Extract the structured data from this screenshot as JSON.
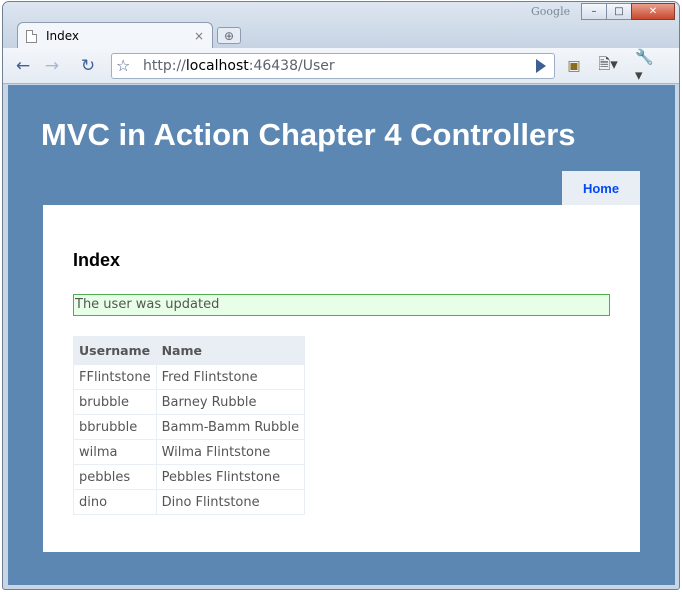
{
  "browser": {
    "brand": "Google",
    "tab": {
      "title": "Index",
      "close": "×"
    },
    "new_tab_icon": "plus-icon",
    "url_scheme": "http://",
    "url_host": "localhost",
    "url_rest": ":46438/User"
  },
  "site": {
    "title": "MVC in Action Chapter 4 Controllers",
    "nav": {
      "home": "Home"
    }
  },
  "page": {
    "heading": "Index",
    "message": "The user was updated",
    "table": {
      "headers": [
        "Username",
        "Name"
      ],
      "rows": [
        [
          "FFlintstone",
          "Fred Flintstone"
        ],
        [
          "brubble",
          "Barney Rubble"
        ],
        [
          "bbrubble",
          "Bamm-Bamm Rubble"
        ],
        [
          "wilma",
          "Wilma Flintstone"
        ],
        [
          "pebbles",
          "Pebbles Flintstone"
        ],
        [
          "dino",
          "Dino Flintstone"
        ]
      ]
    }
  },
  "colors": {
    "header_bg": "#5c87b2",
    "nav_link": "#034af3",
    "message_bg": "#e6ffe6",
    "message_border": "#4caf50"
  }
}
